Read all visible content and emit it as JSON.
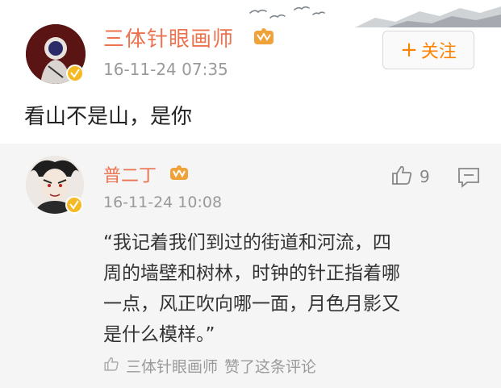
{
  "post": {
    "author": "三体针眼画师",
    "time": "16-11-24 07:35",
    "text": "看山不是山，是你",
    "follow_label": "关注",
    "follow_plus": "+"
  },
  "comment": {
    "author": "普二丁",
    "time": "16-11-24 10:08",
    "like_count": "9",
    "lines": [
      "“我记着我们到过的街道和河流，四",
      "周的墙壁和树林，时钟的针正指着哪",
      "一点，风正吹向哪一面，月色月影又",
      "是什么模样。”"
    ],
    "liked_by_user": "三体针眼画师",
    "liked_by_suffix": "赞了这条评论"
  },
  "colors": {
    "name": "#eb7350",
    "follow": "#ff8200",
    "muted": "#9a9a9a",
    "badge": "#f5b923"
  },
  "icons": {
    "verified": "verified-badge-icon",
    "vip": "vip-crown-icon",
    "like": "thumbs-up-icon",
    "reply": "comment-bubble-icon"
  }
}
